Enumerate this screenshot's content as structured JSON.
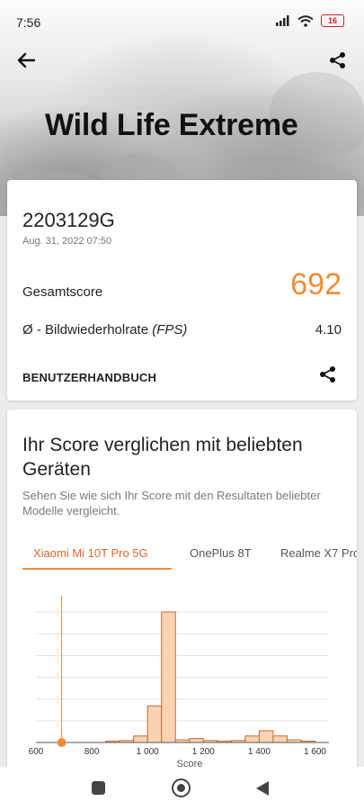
{
  "status_bar": {
    "time": "7:56",
    "battery": "16"
  },
  "header": {
    "title": "Wild Life Extreme"
  },
  "result": {
    "device_name": "2203129G",
    "date": "Aug. 31, 2022 07:50",
    "score_label": "Gesamtscore",
    "score_value": "692",
    "fps_label_prefix": "Ø - Bildwiederholrate ",
    "fps_label_unit": "(FPS)",
    "fps_value": "4.10",
    "manual_label": "BENUTZERHANDBUCH"
  },
  "comparison": {
    "title": "Ihr Score verglichen mit beliebten Geräten",
    "subtitle": "Sehen Sie wie sich Ihr Score mit den Resultaten beliebter Modelle vergleicht.",
    "tabs": [
      {
        "label": "Xiaomi Mi 10T Pro 5G",
        "active": true
      },
      {
        "label": "OnePlus 8T",
        "active": false
      },
      {
        "label": "Realme X7 Pro",
        "active": false
      }
    ]
  },
  "colors": {
    "accent": "#f08c38",
    "bar_fill": "#fbd3b4",
    "bar_stroke": "#c86a2f"
  },
  "chart_data": {
    "type": "bar",
    "title": "",
    "xlabel": "Score",
    "ylabel": "",
    "xlim": [
      600,
      1650
    ],
    "xticks": [
      600,
      800,
      1000,
      1200,
      1400,
      1600
    ],
    "xtick_labels": [
      "600",
      "800",
      "1 000",
      "1 200",
      "1 400",
      "1 600"
    ],
    "ylim": [
      0,
      1
    ],
    "bin_width": 50,
    "bins": [
      {
        "x0": 850,
        "value": 0.01
      },
      {
        "x0": 900,
        "value": 0.015
      },
      {
        "x0": 950,
        "value": 0.05
      },
      {
        "x0": 1000,
        "value": 0.28
      },
      {
        "x0": 1050,
        "value": 1.0
      },
      {
        "x0": 1100,
        "value": 0.02
      },
      {
        "x0": 1150,
        "value": 0.03
      },
      {
        "x0": 1200,
        "value": 0.015
      },
      {
        "x0": 1250,
        "value": 0.01
      },
      {
        "x0": 1300,
        "value": 0.015
      },
      {
        "x0": 1350,
        "value": 0.05
      },
      {
        "x0": 1400,
        "value": 0.09
      },
      {
        "x0": 1450,
        "value": 0.05
      },
      {
        "x0": 1500,
        "value": 0.02
      },
      {
        "x0": 1550,
        "value": 0.01
      }
    ],
    "marker": {
      "x": 692
    },
    "grid": true
  }
}
